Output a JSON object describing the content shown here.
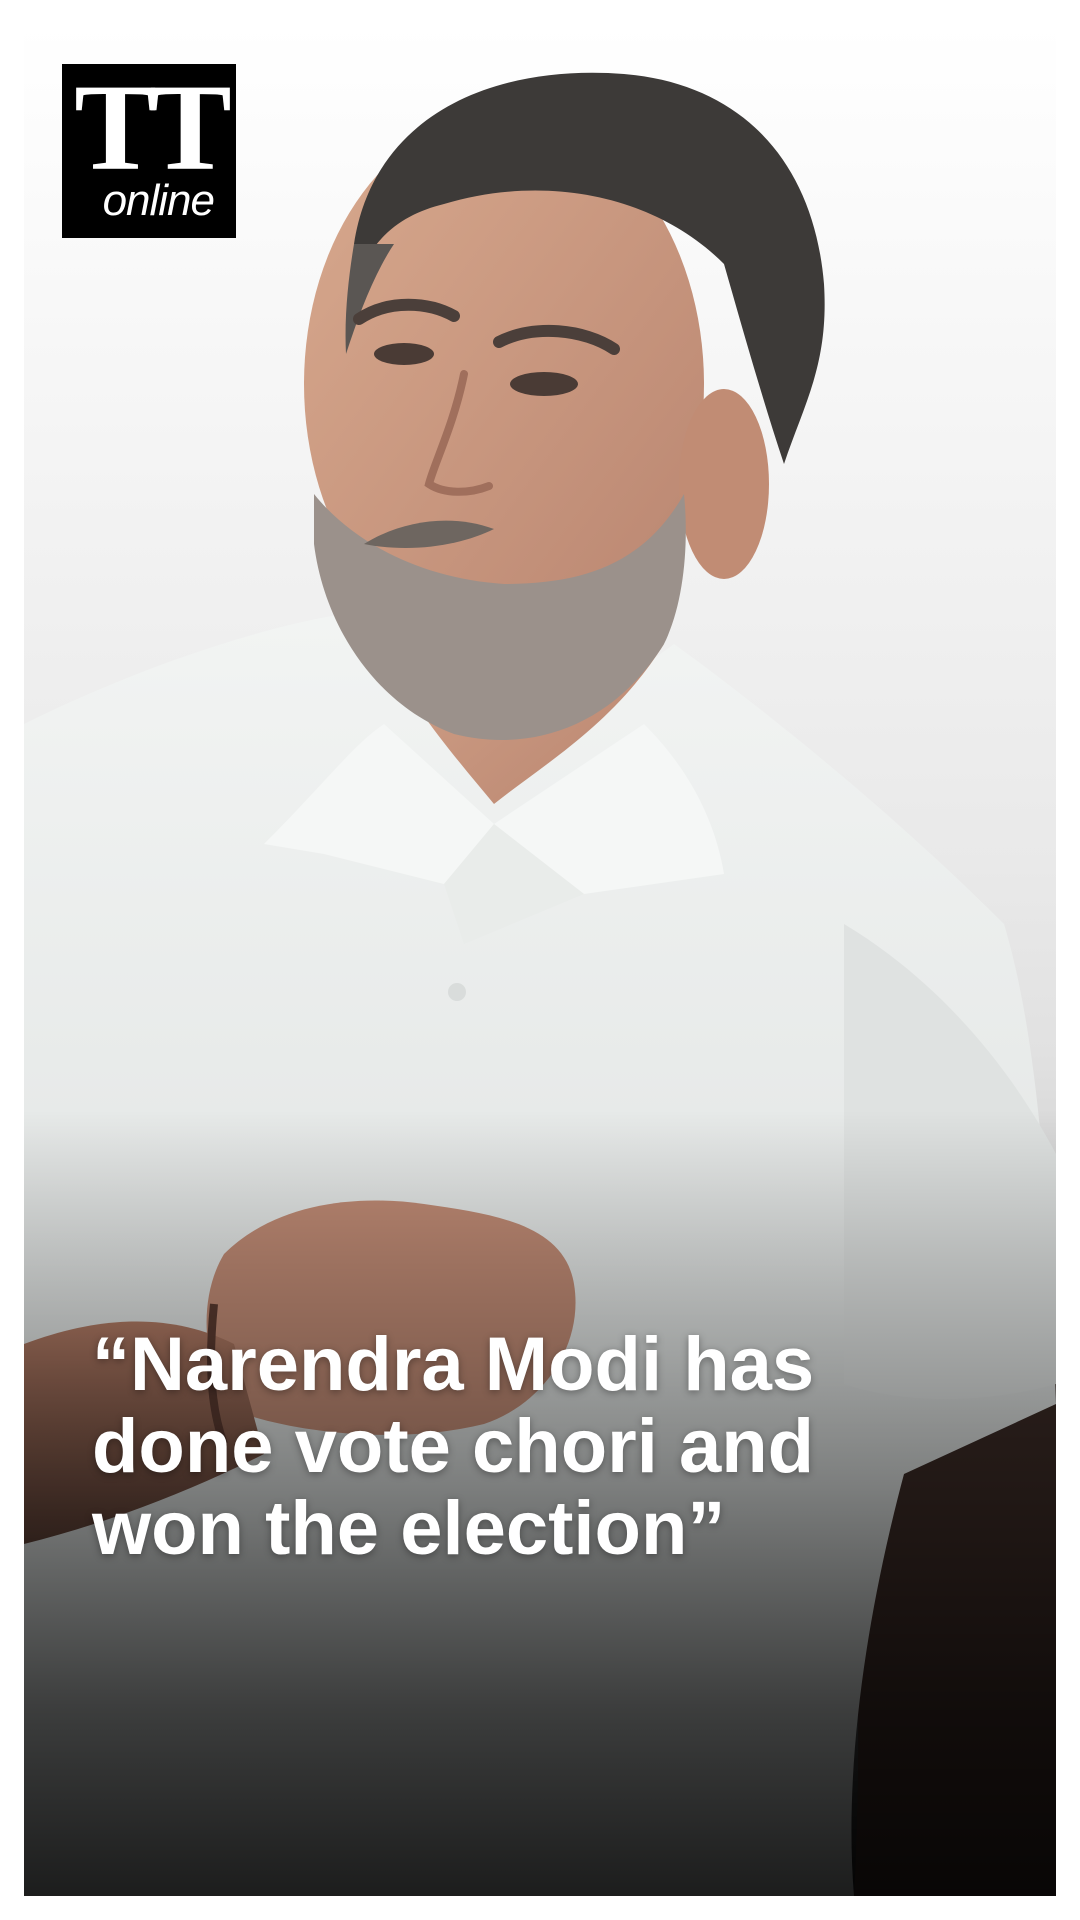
{
  "logo": {
    "mark": "TT",
    "sub": "online"
  },
  "quote": {
    "lines": [
      "“Narendra Modi has",
      "done vote chori and",
      "won the election”"
    ]
  },
  "colors": {
    "logo_background": "#000000",
    "quote_text": "#ffffff",
    "shirt": "#e8ebe9",
    "skin": "#c9957c",
    "hair": "#3d3a38"
  }
}
